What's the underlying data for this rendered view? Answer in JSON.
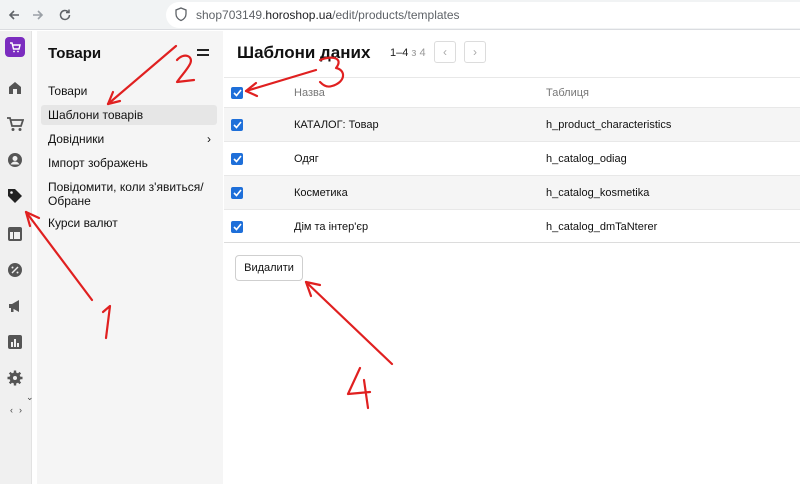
{
  "browser": {
    "url_prefix": "shop703149.",
    "url_domain": "horoshop.ua",
    "url_path": "/edit/products/templates"
  },
  "sidebar": {
    "title": "Товари",
    "items": [
      {
        "label": "Товари",
        "active": false
      },
      {
        "label": "Шаблони товарів",
        "active": true
      },
      {
        "label": "Довідники",
        "has_submenu": true
      },
      {
        "label": "Імпорт зображень"
      },
      {
        "label": "Повідомити, коли з'явиться/ Обране"
      },
      {
        "label": "Курси валют"
      }
    ]
  },
  "main": {
    "title": "Шаблони даних",
    "pager": {
      "range": "1–4",
      "of": "з",
      "total": "4"
    },
    "columns": {
      "name": "Назва",
      "table": "Таблиця"
    },
    "rows": [
      {
        "name": "КАТАЛОГ: Товар",
        "table": "h_product_characteristics",
        "checked": true
      },
      {
        "name": "Одяг",
        "table": "h_catalog_odiag",
        "checked": true
      },
      {
        "name": "Косметика",
        "table": "h_catalog_kosmetika",
        "checked": true
      },
      {
        "name": "Дім та інтер'єр",
        "table": "h_catalog_dmTaNterer",
        "checked": true
      }
    ],
    "delete_label": "Видалити"
  },
  "rail_icons": [
    "logo-icon",
    "home-icon",
    "cart-icon",
    "user-icon",
    "tag-icon",
    "layout-icon",
    "percent-icon",
    "megaphone-icon",
    "chart-icon",
    "gear-icon"
  ],
  "colors": {
    "accent": "#7b2cbf",
    "checkbox": "#1e6fd9",
    "annotation": "#e02020"
  }
}
